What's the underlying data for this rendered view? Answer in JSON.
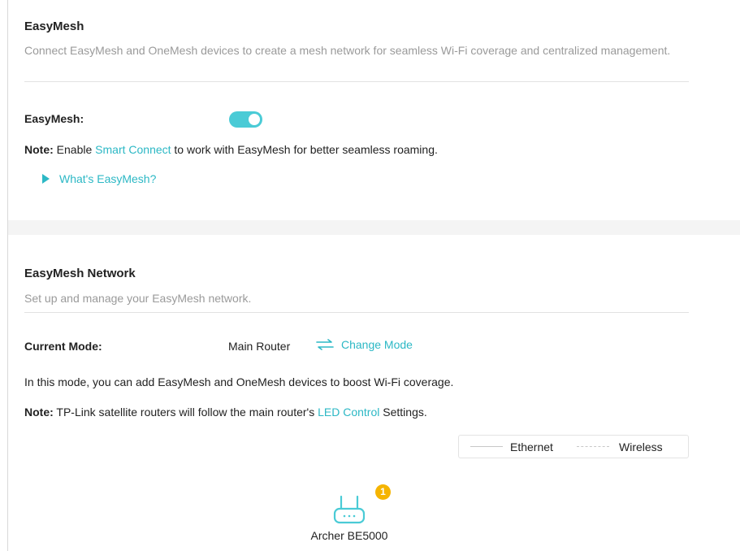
{
  "easymesh_section": {
    "title": "EasyMesh",
    "description": "Connect EasyMesh and OneMesh devices to create a mesh network for seamless Wi-Fi coverage and centralized management.",
    "toggle_label": "EasyMesh:",
    "toggle_state": "on",
    "note_prefix": "Note:",
    "note_before_link": " Enable ",
    "note_link": "Smart Connect",
    "note_after_link": " to work with EasyMesh for better seamless roaming.",
    "help_link": "What's EasyMesh?"
  },
  "network_section": {
    "title": "EasyMesh Network",
    "description": "Set up and manage your EasyMesh network.",
    "mode_label": "Current Mode:",
    "mode_value": "Main Router",
    "change_mode": "Change Mode",
    "info_text": "In this mode, you can add EasyMesh and OneMesh devices to boost Wi-Fi coverage.",
    "note_prefix": "Note:",
    "note_before_link": " TP-Link satellite routers will follow the main router's ",
    "note_link": "LED Control",
    "note_after_link": " Settings.",
    "legend": {
      "ethernet": "Ethernet",
      "wireless": "Wireless"
    },
    "device": {
      "name": "Archer BE5000",
      "badge_count": "1",
      "icon": "router-icon"
    }
  },
  "colors": {
    "accent": "#2cb8c5",
    "toggle_on": "#4acbd6",
    "badge": "#f5b400",
    "muted_text": "#9a9a9a",
    "section_gap": "#f4f4f4"
  }
}
